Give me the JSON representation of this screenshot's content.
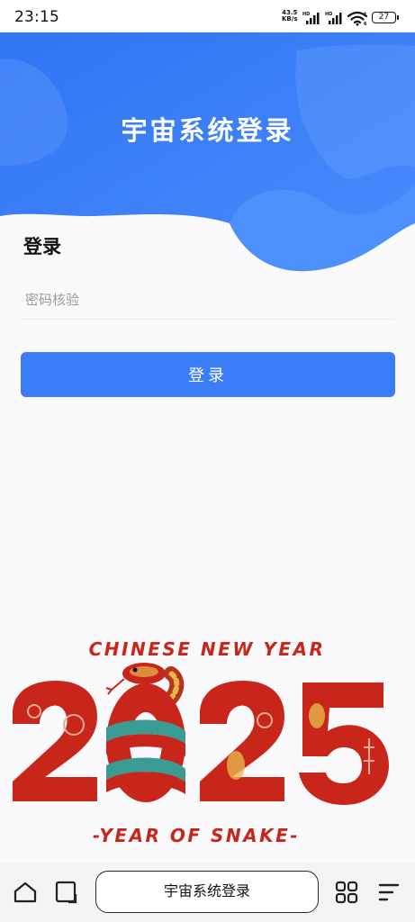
{
  "status_bar": {
    "time": "23:15",
    "net_speed_value": "43.5",
    "net_speed_unit": "KB/s",
    "battery_level": "27"
  },
  "header": {
    "title": "宇宙系统登录",
    "color": "#3b7df8"
  },
  "form": {
    "heading": "登录",
    "password_placeholder": "密码核验",
    "submit_label": "登录"
  },
  "banner": {
    "line1": "CHINESE NEW YEAR",
    "year": "2025",
    "line2": "-YEAR OF SNAKE-",
    "primary_color": "#c8261b"
  },
  "bottom_bar": {
    "address_text": "宇宙系统登录",
    "icons": [
      "home-icon",
      "tab-switch-icon",
      "apps-icon",
      "menu-icon"
    ]
  }
}
